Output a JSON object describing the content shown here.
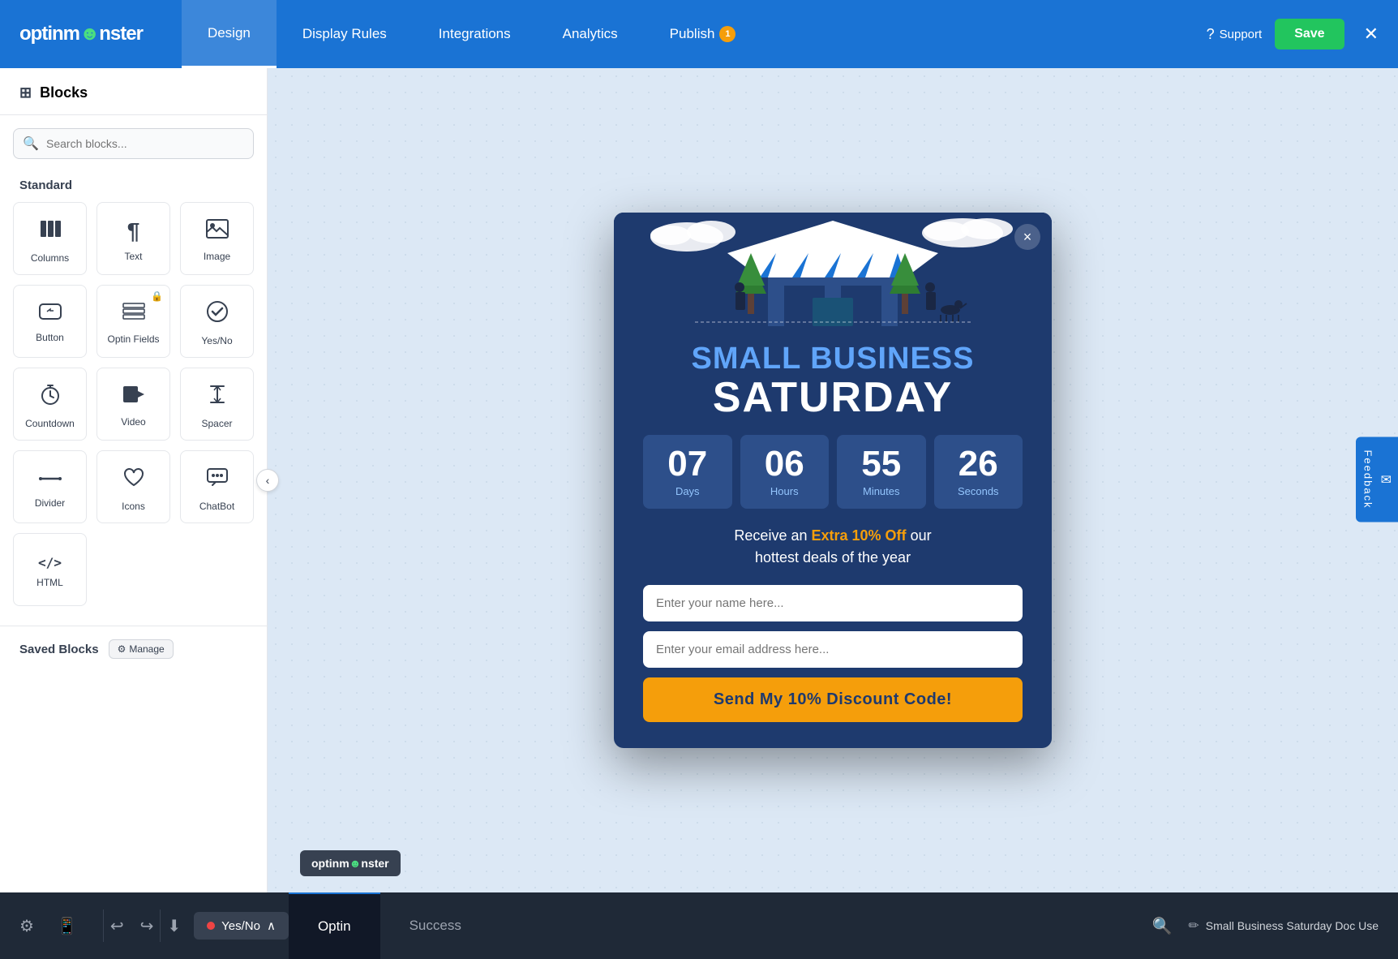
{
  "brand": {
    "logo_text": "optinm",
    "logo_monster": "☻",
    "logo_suffix": "nster"
  },
  "nav": {
    "tabs": [
      {
        "label": "Design",
        "active": true,
        "badge": null
      },
      {
        "label": "Display Rules",
        "active": false,
        "badge": null
      },
      {
        "label": "Integrations",
        "active": false,
        "badge": null
      },
      {
        "label": "Analytics",
        "active": false,
        "badge": null
      },
      {
        "label": "Publish",
        "active": false,
        "badge": "1"
      }
    ],
    "support_label": "Support",
    "save_label": "Save"
  },
  "sidebar": {
    "title": "Blocks",
    "search_placeholder": "Search blocks...",
    "section_standard": "Standard",
    "blocks": [
      {
        "id": "columns",
        "label": "Columns",
        "icon": "⊞",
        "locked": false
      },
      {
        "id": "text",
        "label": "Text",
        "icon": "¶",
        "locked": false
      },
      {
        "id": "image",
        "label": "Image",
        "icon": "🖼",
        "locked": false
      },
      {
        "id": "button",
        "label": "Button",
        "icon": "⊡",
        "locked": false
      },
      {
        "id": "optin-fields",
        "label": "Optin Fields",
        "icon": "≡",
        "locked": true
      },
      {
        "id": "yes-no",
        "label": "Yes/No",
        "icon": "⚖",
        "locked": false
      },
      {
        "id": "countdown",
        "label": "Countdown",
        "icon": "⏰",
        "locked": false
      },
      {
        "id": "video",
        "label": "Video",
        "icon": "▶",
        "locked": false
      },
      {
        "id": "spacer",
        "label": "Spacer",
        "icon": "↕",
        "locked": false
      },
      {
        "id": "divider",
        "label": "Divider",
        "icon": "⟵⟶",
        "locked": false
      },
      {
        "id": "icons",
        "label": "Icons",
        "icon": "♥",
        "locked": false
      },
      {
        "id": "chatbot",
        "label": "ChatBot",
        "icon": "💬",
        "locked": false
      },
      {
        "id": "html",
        "label": "HTML",
        "icon": "</>",
        "locked": false
      }
    ],
    "saved_blocks_label": "Saved Blocks",
    "manage_label": "Manage"
  },
  "popup": {
    "title_line1": "SMALL BUSINESS",
    "title_line2": "SATURDAY",
    "countdown": [
      {
        "num": "07",
        "unit": "Days"
      },
      {
        "num": "06",
        "unit": "Hours"
      },
      {
        "num": "55",
        "unit": "Minutes"
      },
      {
        "num": "26",
        "unit": "Seconds"
      }
    ],
    "description_text": "Receive an",
    "description_highlight": "Extra 10% Off",
    "description_end": "our\nhottest deals of the year",
    "name_placeholder": "Enter your name here...",
    "email_placeholder": "Enter your email address here...",
    "cta_label": "Send My 10% Discount Code!",
    "close_label": "×"
  },
  "watermark": {
    "text": "optinm☻nster"
  },
  "feedback": {
    "label": "Feedback"
  },
  "bottom_bar": {
    "yes_no_label": "Yes/No",
    "tabs": [
      {
        "label": "Optin",
        "active": true
      },
      {
        "label": "Success",
        "active": false
      }
    ],
    "doc_name": "Small Business Saturday Doc Use",
    "edit_icon": "✏"
  },
  "colors": {
    "nav_blue": "#1a73d4",
    "popup_dark": "#1e3a6e",
    "countdown_box": "#2d4f8a",
    "cta_yellow": "#f59e0b",
    "highlight_yellow": "#f59e0b",
    "title_blue": "#60a5fa"
  }
}
